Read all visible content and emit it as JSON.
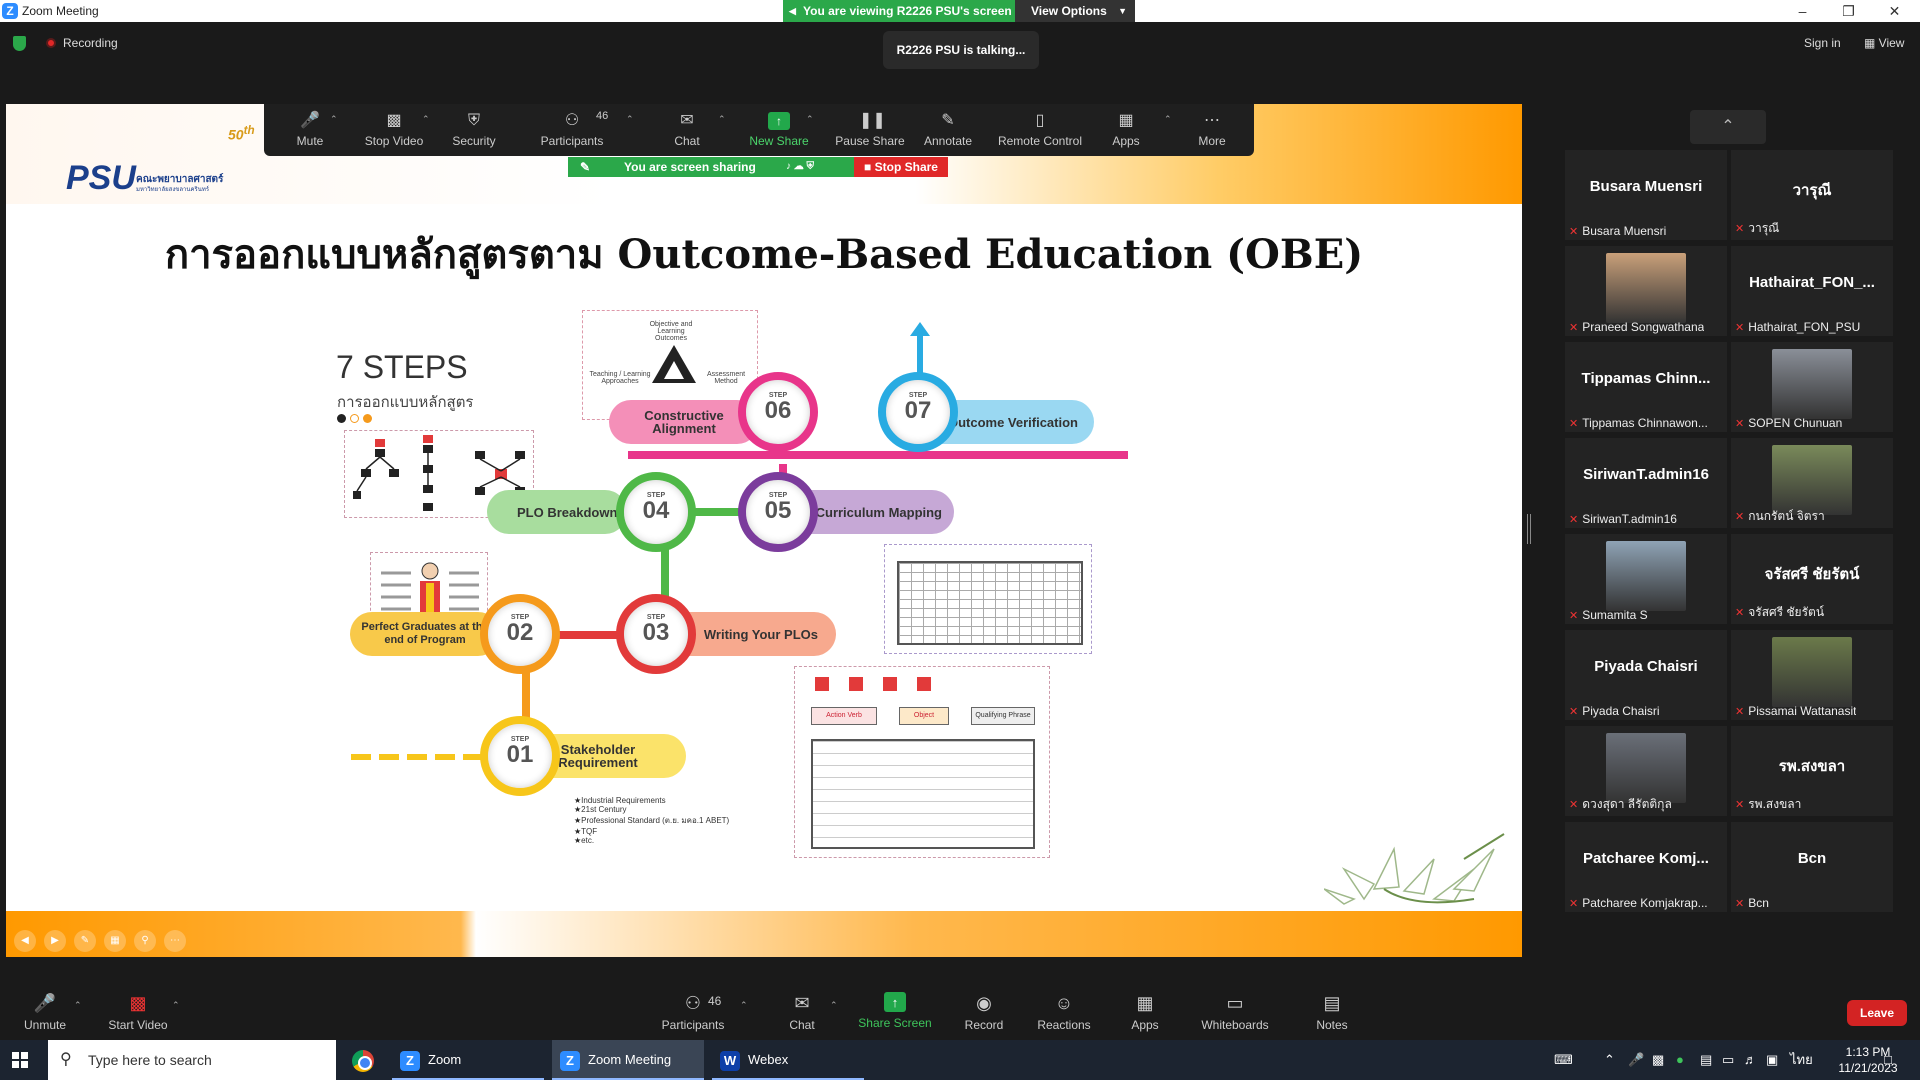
{
  "window": {
    "title": "Zoom Meeting",
    "viewing_banner": "You are viewing R2226 PSU's screen",
    "view_options": "View Options"
  },
  "status": {
    "recording": "Recording",
    "talking": "R2226 PSU is talking...",
    "sign_in": "Sign in",
    "view": "View"
  },
  "share_toolbar": {
    "items": [
      {
        "label": "Mute",
        "icon": "mic-icon"
      },
      {
        "label": "Stop Video",
        "icon": "video-icon"
      },
      {
        "label": "Security",
        "icon": "shield-icon"
      },
      {
        "label": "Participants",
        "icon": "participants-icon",
        "count": "46"
      },
      {
        "label": "Chat",
        "icon": "chat-icon"
      },
      {
        "label": "New Share",
        "icon": "share-icon"
      },
      {
        "label": "Pause Share",
        "icon": "pause-icon"
      },
      {
        "label": "Annotate",
        "icon": "pen-icon"
      },
      {
        "label": "Remote Control",
        "icon": "mouse-icon"
      },
      {
        "label": "Apps",
        "icon": "apps-icon"
      },
      {
        "label": "More",
        "icon": "more-icon"
      }
    ],
    "sharing_status": "You are screen sharing",
    "stop_share": "Stop Share"
  },
  "slide": {
    "title": "การออกแบบหลักสูตรตาม Outcome-Based Education (OBE)",
    "logo_text": "PSU",
    "faculty_line1": "คณะพยาบาลศาสตร์",
    "faculty_line2": "มหาวิทยาลัยสงขลานครินทร์",
    "anniversary": "50",
    "seven_steps": "7 STEPS",
    "seven_steps_sub": "การออกแบบหลักสูตร",
    "steps": [
      {
        "step_label": "STEP",
        "number": "01",
        "name": "Stakeholder Requirement"
      },
      {
        "step_label": "STEP",
        "number": "02",
        "name": "Perfect Graduates at the end of Program"
      },
      {
        "step_label": "STEP",
        "number": "03",
        "name": "Writing Your PLOs"
      },
      {
        "step_label": "STEP",
        "number": "04",
        "name": "PLO Breakdown"
      },
      {
        "step_label": "STEP",
        "number": "05",
        "name": "Curriculum Mapping"
      },
      {
        "step_label": "STEP",
        "number": "06",
        "name": "Constructive Alignment"
      },
      {
        "step_label": "STEP",
        "number": "07",
        "name": "Outcome Verification"
      }
    ],
    "alignment_labels": {
      "top": "Objective and Learning Outcomes",
      "left": "Teaching / Learning Approaches",
      "right": "Assessment Method"
    },
    "stakeholder_list": [
      "Industrial Requirements",
      "21st Century",
      "Professional Standard (ต.ย. มคอ.1 ABET)",
      "TQF",
      "etc."
    ],
    "verb_headers": [
      "Action Verb",
      "Object",
      "Qualifying Phrase"
    ],
    "colors": {
      "step01": "#f7c61a",
      "step02": "#f59a1c",
      "step03": "#e23a3a",
      "step04": "#4fb847",
      "step05": "#7b3c9c",
      "step06": "#e8358a",
      "step07": "#29abe2"
    }
  },
  "gallery": {
    "tiles": [
      {
        "big": "Busara Muensri",
        "label": "Busara Muensri",
        "video": false
      },
      {
        "big": "วารุณี",
        "label": "วารุณี",
        "video": false
      },
      {
        "big": "",
        "label": "Praneed Songwathana",
        "video": true,
        "tint": "#c9a07a"
      },
      {
        "big": "Hathairat_FON_...",
        "label": "Hathairat_FON_PSU",
        "video": false
      },
      {
        "big": "Tippamas  Chinn...",
        "label": "Tippamas Chinnawon...",
        "video": false
      },
      {
        "big": "",
        "label": "SOPEN Chunuan",
        "video": true,
        "tint": "#8a8f98"
      },
      {
        "big": "SiriwanT.admin16",
        "label": "SiriwanT.admin16",
        "video": false
      },
      {
        "big": "",
        "label": "กนกรัตน์ จิตรา",
        "video": true,
        "tint": "#7a8a5a"
      },
      {
        "big": "",
        "label": "Sumamita S",
        "video": true,
        "tint": "#8fa3b5"
      },
      {
        "big": "จรัสศรี ชัยรัตน์",
        "label": "จรัสศรี ชัยรัตน์",
        "video": false
      },
      {
        "big": "Piyada Chaisri",
        "label": "Piyada Chaisri",
        "video": false
      },
      {
        "big": "",
        "label": "Pissamai Wattanasit",
        "video": true,
        "tint": "#6b7a4a"
      },
      {
        "big": "",
        "label": "ดวงสุดา ลีรัตติกุล",
        "video": true,
        "tint": "#6a6f78"
      },
      {
        "big": "รพ.สงขลา",
        "label": "รพ.สงขลา",
        "video": false
      },
      {
        "big": "Patcharee  Komj...",
        "label": "Patcharee Komjakrap...",
        "video": false
      },
      {
        "big": "Bcn",
        "label": "Bcn",
        "video": false
      }
    ]
  },
  "bottom_toolbar": {
    "unmute": "Unmute",
    "start_video": "Start Video",
    "participants": "Participants",
    "participants_count": "46",
    "chat": "Chat",
    "share_screen": "Share Screen",
    "record": "Record",
    "reactions": "Reactions",
    "apps": "Apps",
    "whiteboards": "Whiteboards",
    "notes": "Notes",
    "leave": "Leave"
  },
  "taskbar": {
    "search_placeholder": "Type here to search",
    "apps": [
      "Zoom",
      "Zoom Meeting",
      "Webex"
    ],
    "time": "1:13 PM",
    "date": "11/21/2023",
    "lang": "ไทย"
  }
}
